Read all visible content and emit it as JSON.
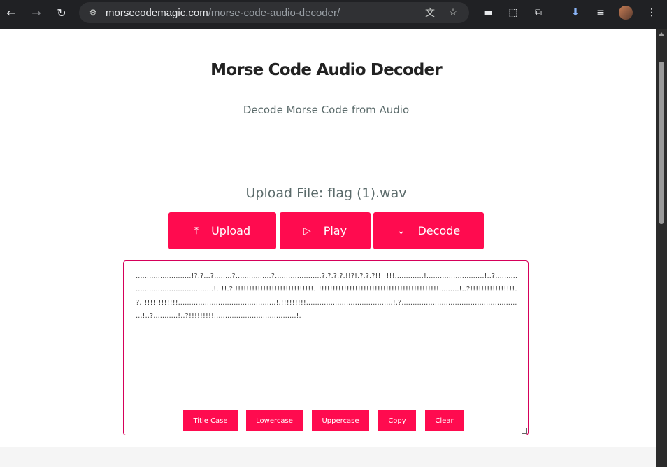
{
  "browser": {
    "url_domain": "morsecodemagic.com",
    "url_path": "/morse-code-audio-decoder/",
    "icons": {
      "back": "←",
      "forward": "→",
      "reload": "↻",
      "site_info": "⚙",
      "translate": "文",
      "bookmark": "☆",
      "extension_hat": "▬",
      "screenshot": "⬚",
      "extensions": "⧉",
      "download": "⬇",
      "media": "≡",
      "menu": "⋮"
    }
  },
  "header": {
    "title": "Morse Code Audio Decoder",
    "subtitle": "Decode Morse Code from Audio"
  },
  "upload": {
    "label": "Upload File: flag (1).wav"
  },
  "buttons": {
    "upload": {
      "label": "Upload",
      "icon": "⤒"
    },
    "play": {
      "label": "Play",
      "icon": "▷"
    },
    "decode": {
      "label": "Decode",
      "icon": "⌄"
    }
  },
  "output": {
    "text": ".........................!?.?...?........?................?.....................?.?.?.?.!!?!.?.?.?!!!!!!!.............!..........................!..?.............................................!.!!!.?.!!!!!!!!!!!!!!!!!!!!!!!!!!!!.!!!!!!!!!!!!!!!!!!!!!!!!!!!!!!!!!!!!!!!!!!!!.........!..?!!!!!!!!!!!!!!!!.?.!!!!!!!!!!!!!............................................!.!!!!!!!!!.......................................!.?.......................................................!..?...........!..?!!!!!!!!!.....................................!."
  },
  "actions": {
    "title_case": "Title Case",
    "lowercase": "Lowercase",
    "uppercase": "Uppercase",
    "copy": "Copy",
    "clear": "Clear"
  },
  "colors": {
    "accent": "#ff0b4f",
    "chrome_bg": "#202124",
    "omnibox_bg": "#303134",
    "title_text": "#222222",
    "muted_text": "#5b6b6b"
  }
}
